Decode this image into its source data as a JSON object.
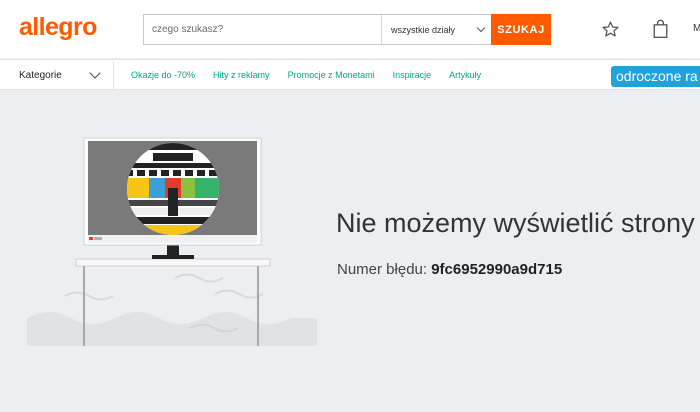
{
  "header": {
    "logo": "allegro",
    "search_placeholder": "czego szukasz?",
    "category_value": "wszystkie działy",
    "search_button": "SZUKAJ",
    "cut_text": "M"
  },
  "nav": {
    "categories_label": "Kategorie",
    "links": [
      "Okazje do -70%",
      "Hity z reklamy",
      "Promocje z Monetami",
      "Inspiracje",
      "Artykuły"
    ],
    "promo": "odroczone ra"
  },
  "error": {
    "title": "Nie możemy wyświetlić strony",
    "code_label": "Numer błędu:",
    "code": "9fc6952990a9d715"
  },
  "colors": {
    "brand": "#ff5a00",
    "link": "#00a790",
    "promo": "#1ea3da",
    "background": "#eceff1"
  }
}
